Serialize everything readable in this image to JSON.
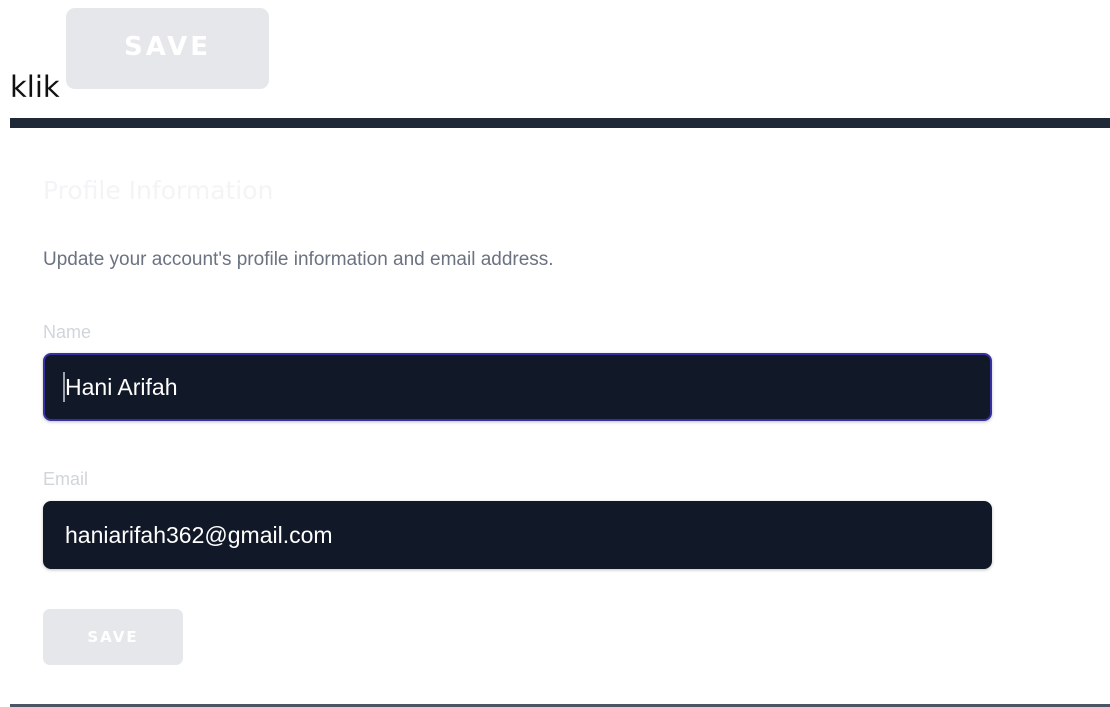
{
  "instruction": {
    "prefix": "klik",
    "button_label": "SAVE"
  },
  "profile": {
    "title": "Profile Information",
    "description": "Update your account's profile information and email address.",
    "fields": {
      "name_label": "Name",
      "name_value": "Hani Arifah",
      "email_label": "Email",
      "email_value": "haniarifah362@gmail.com"
    },
    "save_label": "SAVE"
  },
  "colors": {
    "input_background": "#111827",
    "focus_border": "#3730a3",
    "disabled_button": "#e5e7eb",
    "divider": "#1f2937"
  }
}
